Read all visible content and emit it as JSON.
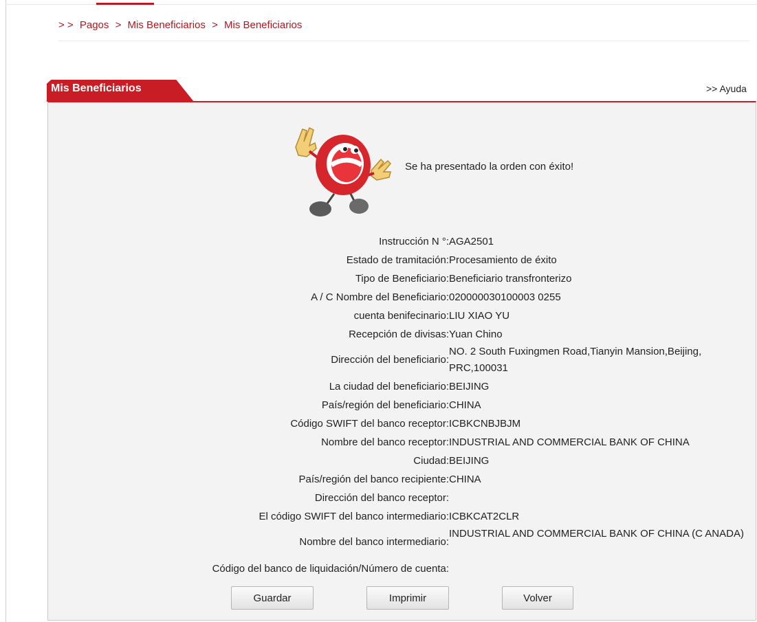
{
  "breadcrumb": {
    "prefix": "> >",
    "items": [
      "Pagos",
      "Mis Beneficiarios",
      "Mis Beneficiarios"
    ],
    "separator": ">"
  },
  "panel": {
    "title": "Mis Beneficiarios",
    "help_link": ">> Ayuda"
  },
  "result": {
    "message": "Se ha presentado la orden con éxito!",
    "mascot_icon": "success-mascot-icon"
  },
  "details": [
    {
      "label": "Instrucción N °:",
      "value": "AGA2501"
    },
    {
      "label": "Estado de tramitación:",
      "value": "Procesamiento de éxito"
    },
    {
      "label": "Tipo de Beneficiario:",
      "value": "Beneficiario transfronterizo"
    },
    {
      "label": "A / C Nombre del Beneficiario:",
      "value": "020000030100003 0255"
    },
    {
      "label": "cuenta benifecinario:",
      "value": "LIU XIAO YU"
    },
    {
      "label": "Recepción de divisas:",
      "value": "Yuan Chino"
    },
    {
      "label": "Dirección del beneficiario:",
      "value": "NO. 2 South Fuxingmen Road,Tianyin Mansion,Beijing, PRC,100031"
    },
    {
      "label": "La ciudad del beneficiario:",
      "value": "BEIJING"
    },
    {
      "label": "País/región del beneficiario:",
      "value": "CHINA"
    },
    {
      "label": "Código SWIFT del banco receptor:",
      "value": "ICBKCNBJBJM"
    },
    {
      "label": "Nombre del banco receptor:",
      "value": "INDUSTRIAL AND COMMERCIAL BANK OF CHINA"
    },
    {
      "label": "Ciudad:",
      "value": "BEIJING"
    },
    {
      "label": "País/región del banco recipiente:",
      "value": "CHINA"
    },
    {
      "label": "Dirección del banco receptor:",
      "value": ""
    },
    {
      "label": "El código SWIFT del banco intermediario:",
      "value": "ICBKCAT2CLR"
    },
    {
      "label": "Nombre del banco intermediario:",
      "value": "INDUSTRIAL AND COMMERCIAL BANK OF CHINA (C ANADA)"
    },
    {
      "label": "Código del banco de liquidación/Número de cuenta:",
      "value": ""
    }
  ],
  "buttons": {
    "save": "Guardar",
    "print": "Imprimir",
    "back": "Volver"
  },
  "colors": {
    "accent": "#c81d25",
    "panel_bg": "#f3f3f3",
    "link": "#b0171f"
  }
}
